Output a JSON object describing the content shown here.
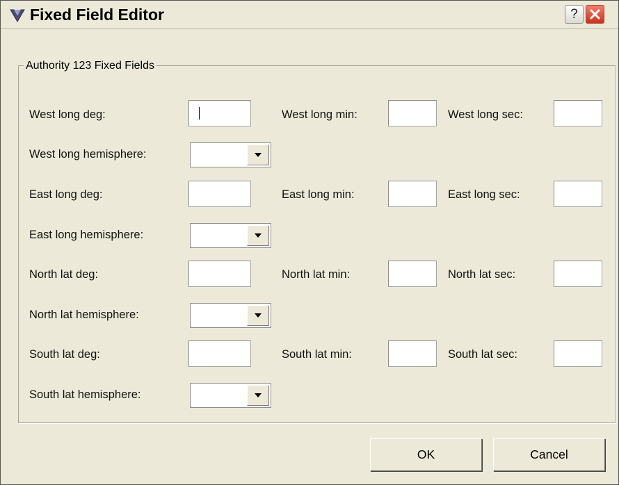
{
  "window": {
    "title": "Fixed Field Editor",
    "help_label": "?",
    "close_label": "✕"
  },
  "group": {
    "title": "Authority 123 Fixed Fields"
  },
  "fields": {
    "west_long_deg": {
      "label": "West long deg:",
      "value": ""
    },
    "west_long_min": {
      "label": "West long min:",
      "value": ""
    },
    "west_long_sec": {
      "label": "West long sec:",
      "value": ""
    },
    "west_long_hemisphere": {
      "label": "West long hemisphere:",
      "value": ""
    },
    "east_long_deg": {
      "label": "East long deg:",
      "value": ""
    },
    "east_long_min": {
      "label": "East long min:",
      "value": ""
    },
    "east_long_sec": {
      "label": "East long sec:",
      "value": ""
    },
    "east_long_hemisphere": {
      "label": "East long hemisphere:",
      "value": ""
    },
    "north_lat_deg": {
      "label": "North lat deg:",
      "value": ""
    },
    "north_lat_min": {
      "label": "North lat min:",
      "value": ""
    },
    "north_lat_sec": {
      "label": "North lat sec:",
      "value": ""
    },
    "north_lat_hemisphere": {
      "label": "North lat hemisphere:",
      "value": ""
    },
    "south_lat_deg": {
      "label": "South lat deg:",
      "value": ""
    },
    "south_lat_min": {
      "label": "South lat min:",
      "value": ""
    },
    "south_lat_sec": {
      "label": "South lat sec:",
      "value": ""
    },
    "south_lat_hemisphere": {
      "label": "South lat hemisphere:",
      "value": ""
    }
  },
  "buttons": {
    "ok": "OK",
    "cancel": "Cancel"
  },
  "colors": {
    "dialog_background": "#ece9d8",
    "close_button": "#c8321d",
    "field_background": "#ffffff"
  }
}
